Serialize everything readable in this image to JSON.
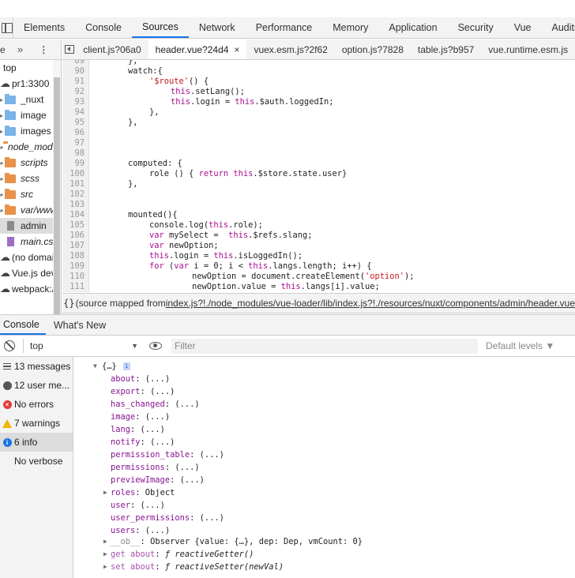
{
  "main_tabs": [
    "Elements",
    "Console",
    "Sources",
    "Network",
    "Performance",
    "Memory",
    "Application",
    "Security",
    "Vue",
    "Audits"
  ],
  "active_main_tab": "Sources",
  "navigator": {
    "header_tab": "e",
    "more": "»",
    "kebab": "⋮",
    "items": [
      {
        "label": "top",
        "kind": "frame"
      },
      {
        "label": "pr1:3300",
        "kind": "cloud"
      },
      {
        "label": "_nuxt",
        "kind": "folder-blue"
      },
      {
        "label": "image",
        "kind": "folder-blue"
      },
      {
        "label": "images",
        "kind": "folder-blue"
      },
      {
        "label": "node_modules",
        "kind": "folder-orange"
      },
      {
        "label": "scripts",
        "kind": "folder-orange"
      },
      {
        "label": "scss",
        "kind": "folder-orange"
      },
      {
        "label": "src",
        "kind": "folder-orange"
      },
      {
        "label": "var/www",
        "kind": "folder-orange"
      },
      {
        "label": "admin",
        "kind": "file-gray"
      },
      {
        "label": "main.css",
        "kind": "file-purple"
      },
      {
        "label": "(no domain)",
        "kind": "cloud"
      },
      {
        "label": "Vue.js devtools",
        "kind": "cloud"
      },
      {
        "label": "webpack://",
        "kind": "cloud"
      }
    ]
  },
  "file_tabs": [
    {
      "label": "client.js?06a0",
      "active": false
    },
    {
      "label": "header.vue?24d4",
      "active": true,
      "close": "×"
    },
    {
      "label": "vuex.esm.js?2f62",
      "active": false
    },
    {
      "label": "option.js?7828",
      "active": false
    },
    {
      "label": "table.js?b957",
      "active": false
    },
    {
      "label": "vue.runtime.esm.js",
      "active": false
    }
  ],
  "code": {
    "lines": [
      {
        "n": "89",
        "t": "},"
      },
      {
        "n": "90",
        "t": "watch:{"
      },
      {
        "n": "91",
        "t": "'$route'() {"
      },
      {
        "n": "92",
        "t": "this.setLang();"
      },
      {
        "n": "93",
        "t": "this.login = this.$auth.loggedIn;"
      },
      {
        "n": "94",
        "t": "},"
      },
      {
        "n": "95",
        "t": "},"
      },
      {
        "n": "96",
        "t": ""
      },
      {
        "n": "97",
        "t": ""
      },
      {
        "n": "98",
        "t": ""
      },
      {
        "n": "99",
        "t": "computed: {"
      },
      {
        "n": "100",
        "t": "role () { return this.$store.state.user}"
      },
      {
        "n": "101",
        "t": "},"
      },
      {
        "n": "102",
        "t": ""
      },
      {
        "n": "103",
        "t": ""
      },
      {
        "n": "104",
        "t": "mounted(){"
      },
      {
        "n": "105",
        "t": "console.log(this.role);"
      },
      {
        "n": "106",
        "t": "var mySelect =  this.$refs.slang;"
      },
      {
        "n": "107",
        "t": "var newOption;"
      },
      {
        "n": "108",
        "t": "this.login = this.isLoggedIn();"
      },
      {
        "n": "109",
        "t": "for (var i = 0; i < this.langs.length; i++) {"
      },
      {
        "n": "110",
        "t": "newOption = document.createElement('option');"
      },
      {
        "n": "111",
        "t": "newOption.value = this.langs[i].value;"
      }
    ]
  },
  "status": {
    "brace": "{}",
    "prefix": "(source mapped from ",
    "link": "index.js?!./node_modules/vue-loader/lib/index.js?!./resources/nuxt/components/admin/header.vue"
  },
  "drawer_tabs": [
    "Console",
    "What's New"
  ],
  "console_toolbar": {
    "context": "top",
    "filter_placeholder": "Filter",
    "levels": "Default levels ▼"
  },
  "console_sidebar": [
    {
      "label": "13 messages",
      "icon": "list-icon"
    },
    {
      "label": "12 user me...",
      "icon": "user-icon"
    },
    {
      "label": "No errors",
      "icon": "error-icon"
    },
    {
      "label": "7 warnings",
      "icon": "warning-icon"
    },
    {
      "label": "6 info",
      "icon": "info-icon",
      "selected": true
    },
    {
      "label": "No verbose",
      "icon": "verbose-icon"
    }
  ],
  "console_output": {
    "root": "{…}",
    "props": [
      {
        "k": "about",
        "v": "(...)"
      },
      {
        "k": "export",
        "v": "(...)"
      },
      {
        "k": "has_changed",
        "v": "(...)"
      },
      {
        "k": "image",
        "v": "(...)"
      },
      {
        "k": "lang",
        "v": "(...)"
      },
      {
        "k": "notify",
        "v": "(...)"
      },
      {
        "k": "permission_table",
        "v": "(...)"
      },
      {
        "k": "permissions",
        "v": "(...)"
      },
      {
        "k": "previewImage",
        "v": "(...)"
      },
      {
        "k": "roles",
        "v": "Object"
      },
      {
        "k": "user",
        "v": "(...)"
      },
      {
        "k": "user_permissions",
        "v": "(...)"
      },
      {
        "k": "users",
        "v": "(...)"
      }
    ],
    "ob_key": "__ob__",
    "ob_val": "Observer {value: {…}, dep: Dep, vmCount: 0}",
    "get_about_key": "get about",
    "get_about_val": "ƒ reactiveGetter()",
    "set_about_key": "set about",
    "set_about_val": "ƒ reactiveSetter(newVal)"
  }
}
